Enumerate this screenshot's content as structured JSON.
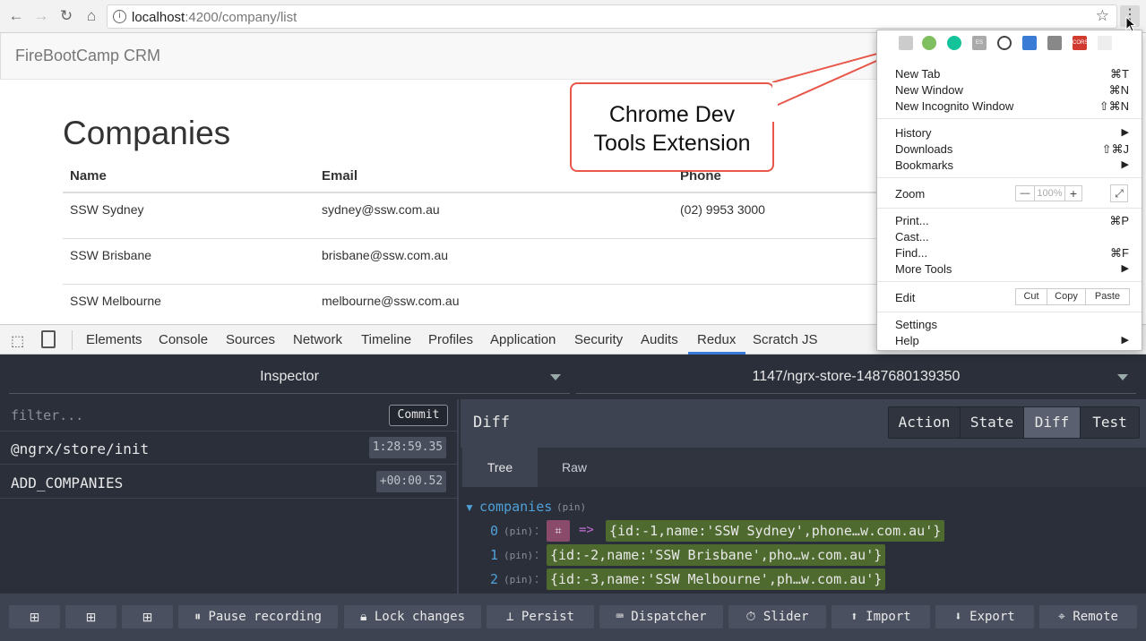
{
  "browser": {
    "url_host": "localhost",
    "url_path": ":4200/company/list"
  },
  "app": {
    "brand": "FireBootCamp CRM",
    "title": "Companies",
    "columns": [
      "Name",
      "Email",
      "Phone"
    ],
    "rows": [
      {
        "name": "SSW Sydney",
        "email": "sydney@ssw.com.au",
        "phone": "(02) 9953 3000"
      },
      {
        "name": "SSW Brisbane",
        "email": "brisbane@ssw.com.au",
        "phone": ""
      },
      {
        "name": "SSW Melbourne",
        "email": "melbourne@ssw.com.au",
        "phone": ""
      }
    ]
  },
  "callout": {
    "line1": "Chrome Dev",
    "line2": "Tools Extension"
  },
  "menu": {
    "new_tab": "New Tab",
    "new_tab_sc": "⌘T",
    "new_window": "New Window",
    "new_window_sc": "⌘N",
    "incognito": "New Incognito Window",
    "incognito_sc": "⇧⌘N",
    "history": "History",
    "downloads": "Downloads",
    "downloads_sc": "⇧⌘J",
    "bookmarks": "Bookmarks",
    "zoom": "Zoom",
    "zoom_minus": "—",
    "zoom_value": "100%",
    "zoom_plus": "+",
    "print": "Print...",
    "print_sc": "⌘P",
    "cast": "Cast...",
    "find": "Find...",
    "find_sc": "⌘F",
    "more_tools": "More Tools",
    "edit": "Edit",
    "cut": "Cut",
    "copy": "Copy",
    "paste": "Paste",
    "settings": "Settings",
    "help": "Help",
    "ext_cors": "CORS",
    "ext_es": "ES"
  },
  "devtools": {
    "tabs": [
      "Elements",
      "Console",
      "Sources",
      "Network",
      "Timeline",
      "Profiles",
      "Application",
      "Security",
      "Audits",
      "Redux",
      "Scratch JS"
    ],
    "active_tab": "Redux"
  },
  "redux": {
    "inspector": "Inspector",
    "instance": "1147/ngrx-store-1487680139350",
    "filter_placeholder": "filter...",
    "commit": "Commit",
    "actions": [
      {
        "name": "@ngrx/store/init",
        "time": "1:28:59.35"
      },
      {
        "name": "ADD_COMPANIES",
        "time": "+00:00.52"
      }
    ],
    "diff_label": "Diff",
    "mode_tabs": [
      "Action",
      "State",
      "Diff",
      "Test"
    ],
    "active_mode": "Diff",
    "sub_tabs": [
      "Tree",
      "Raw"
    ],
    "active_sub": "Tree",
    "tree_root": "companies",
    "pin": "(pin)",
    "arrow": "=>",
    "items": [
      {
        "index": "0",
        "value": "{id:-1,name:'SSW Sydney',phone…w.com.au'}"
      },
      {
        "index": "1",
        "value": "{id:-2,name:'SSW Brisbane',pho…w.com.au'}"
      },
      {
        "index": "2",
        "value": "{id:-3,name:'SSW Melbourne',ph…w.com.au'}"
      }
    ],
    "bottom_buttons": [
      "Pause recording",
      "Lock changes",
      "Persist",
      "Dispatcher",
      "Slider",
      "Import",
      "Export",
      "Remote"
    ]
  }
}
